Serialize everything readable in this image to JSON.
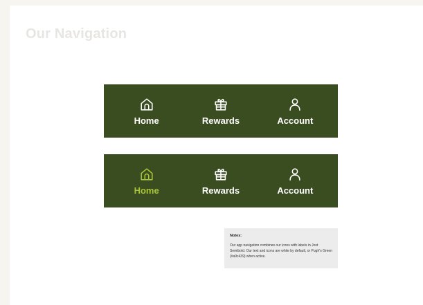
{
  "page": {
    "title": "Our Navigation"
  },
  "nav_default": {
    "items": [
      {
        "label": "Home",
        "icon": "home-icon",
        "active": false
      },
      {
        "label": "Rewards",
        "icon": "gift-icon",
        "active": false
      },
      {
        "label": "Account",
        "icon": "user-icon",
        "active": false
      }
    ]
  },
  "nav_active": {
    "items": [
      {
        "label": "Home",
        "icon": "home-icon",
        "active": true
      },
      {
        "label": "Rewards",
        "icon": "gift-icon",
        "active": false
      },
      {
        "label": "Account",
        "icon": "user-icon",
        "active": false
      }
    ]
  },
  "notes": {
    "title": "Notes:",
    "body": "Our app navigation combines our icons with labels in Jost Semibold. Our text and icons are white by default, or Pugh's Green (#a9c439) when active."
  },
  "colors": {
    "nav_background": "#3a4d20",
    "default_text": "#ffffff",
    "active_text": "#a9c439",
    "page_background": "#f7f5ef",
    "card_background": "#ffffff",
    "notes_background": "#ececec"
  }
}
